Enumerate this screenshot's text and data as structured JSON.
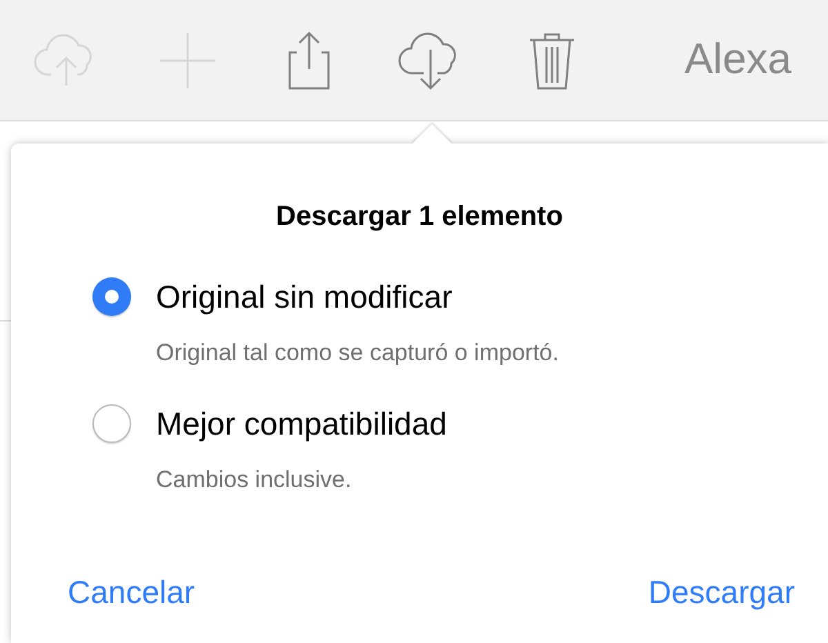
{
  "toolbar": {
    "items": [
      {
        "kind": "upload",
        "disabled": true
      },
      {
        "kind": "add",
        "disabled": true
      },
      {
        "kind": "share",
        "disabled": false
      },
      {
        "kind": "download",
        "disabled": false
      },
      {
        "kind": "delete",
        "disabled": false
      }
    ],
    "user_name": "Alexa"
  },
  "popover": {
    "title": "Descargar 1 elemento",
    "options": [
      {
        "label": "Original sin modificar",
        "description": "Original tal como se capturó o importó.",
        "selected": true
      },
      {
        "label": "Mejor compatibilidad",
        "description": "Cambios inclusive.",
        "selected": false
      }
    ],
    "buttons": [
      {
        "label": "Cancelar"
      },
      {
        "label": "Descargar"
      }
    ]
  }
}
